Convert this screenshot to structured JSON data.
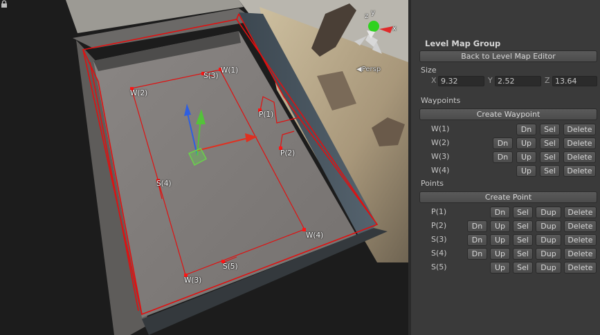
{
  "scene": {
    "gizmo_axes": {
      "x": "x",
      "y": "y",
      "z": "z"
    },
    "view_label": "Persp",
    "markers": [
      "W(1)",
      "W(2)",
      "W(3)",
      "W(4)",
      "S(3)",
      "S(4)",
      "S(5)",
      "P(1)",
      "P(2)"
    ]
  },
  "inspector": {
    "title": "Level Map Group",
    "back_button": "Back to Level Map Editor",
    "size": {
      "label": "Size",
      "x_label": "X",
      "x_value": "9.32",
      "y_label": "Y",
      "y_value": "2.52",
      "z_label": "Z",
      "z_value": "13.64"
    },
    "waypoints": {
      "label": "Waypoints",
      "create_button": "Create Waypoint",
      "rows": [
        {
          "label": "W(1)",
          "buttons": [
            "Dn",
            "Sel",
            "Delete"
          ]
        },
        {
          "label": "W(2)",
          "buttons": [
            "Dn",
            "Up",
            "Sel",
            "Delete"
          ]
        },
        {
          "label": "W(3)",
          "buttons": [
            "Dn",
            "Up",
            "Sel",
            "Delete"
          ]
        },
        {
          "label": "W(4)",
          "buttons": [
            "Up",
            "Sel",
            "Delete"
          ]
        }
      ]
    },
    "points": {
      "label": "Points",
      "create_button": "Create Point",
      "rows": [
        {
          "label": "P(1)",
          "buttons": [
            "Dn",
            "Sel",
            "Dup",
            "Delete"
          ]
        },
        {
          "label": "P(2)",
          "buttons": [
            "Dn",
            "Up",
            "Sel",
            "Dup",
            "Delete"
          ]
        },
        {
          "label": "S(3)",
          "buttons": [
            "Dn",
            "Up",
            "Sel",
            "Dup",
            "Delete"
          ]
        },
        {
          "label": "S(4)",
          "buttons": [
            "Dn",
            "Up",
            "Sel",
            "Dup",
            "Delete"
          ]
        },
        {
          "label": "S(5)",
          "buttons": [
            "Up",
            "Sel",
            "Dup",
            "Delete"
          ]
        }
      ]
    }
  },
  "colors": {
    "path_red": "#e01010",
    "inspector_bg": "#3a3a3a",
    "button_bg": "#505050",
    "field_bg": "#2b2b2b"
  }
}
